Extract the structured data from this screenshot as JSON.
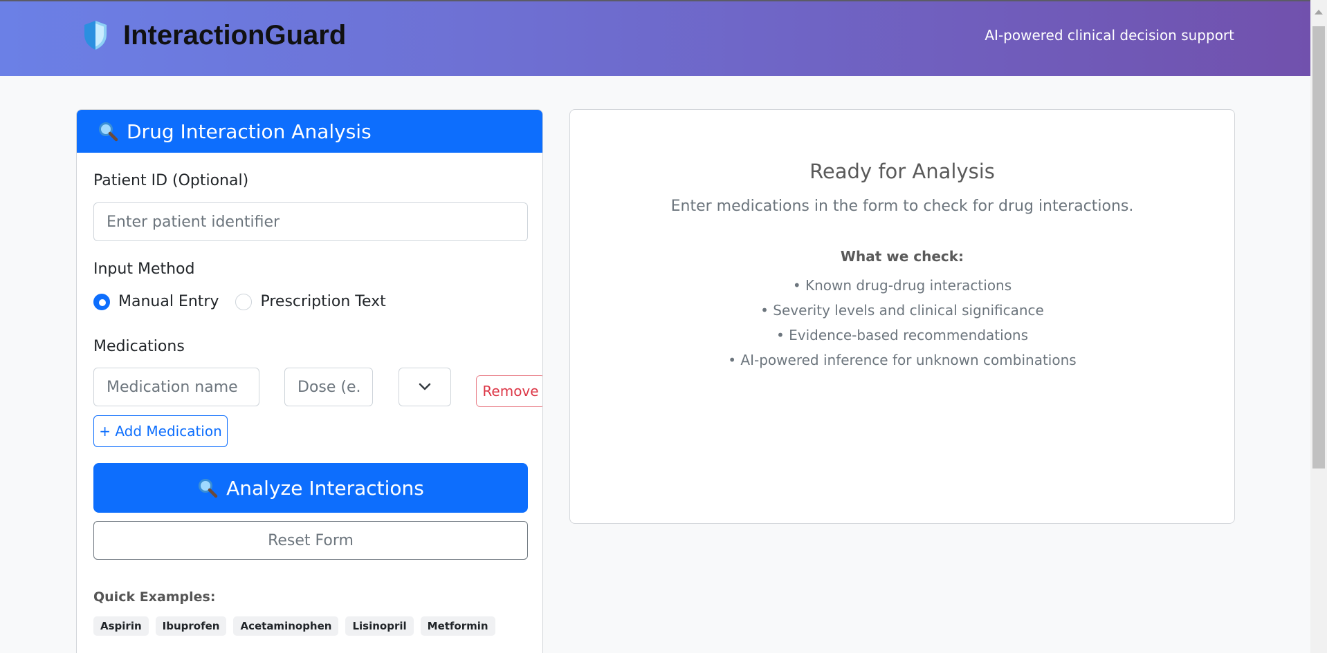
{
  "header": {
    "app_name": "InteractionGuard",
    "tagline": "AI-powered clinical decision support",
    "logo_icon": "shield-icon",
    "gradient": [
      "#6b80e6",
      "#7151ad"
    ]
  },
  "form": {
    "title": "Drug Interaction Analysis",
    "title_icon": "magnifier-icon",
    "patient_id": {
      "label": "Patient ID (Optional)",
      "placeholder": "Enter patient identifier",
      "value": ""
    },
    "input_method": {
      "label": "Input Method",
      "options": [
        {
          "label": "Manual Entry",
          "checked": true
        },
        {
          "label": "Prescription Text",
          "checked": false
        }
      ]
    },
    "medications": {
      "label": "Medications",
      "name_placeholder": "Medication name",
      "dose_placeholder": "Dose (e.g",
      "select_value": "",
      "remove_label": "Remove",
      "add_label": "+ Add Medication"
    },
    "analyze_label": "Analyze Interactions",
    "analyze_icon": "magnifier-icon",
    "reset_label": "Reset Form",
    "quick_examples": {
      "label": "Quick Examples:",
      "items": [
        "Aspirin",
        "Ibuprofen",
        "Acetaminophen",
        "Lisinopril",
        "Metformin"
      ]
    }
  },
  "results": {
    "title": "Ready for Analysis",
    "subtitle": "Enter medications in the form to check for drug interactions.",
    "check_title": "What we check:",
    "checks": [
      "• Known drug-drug interactions",
      "• Severity levels and clinical significance",
      "• Evidence-based recommendations",
      "• AI-powered inference for unknown combinations"
    ]
  },
  "colors": {
    "primary": "#0d6efd",
    "danger": "#dc3545",
    "secondary": "#6c757d"
  }
}
